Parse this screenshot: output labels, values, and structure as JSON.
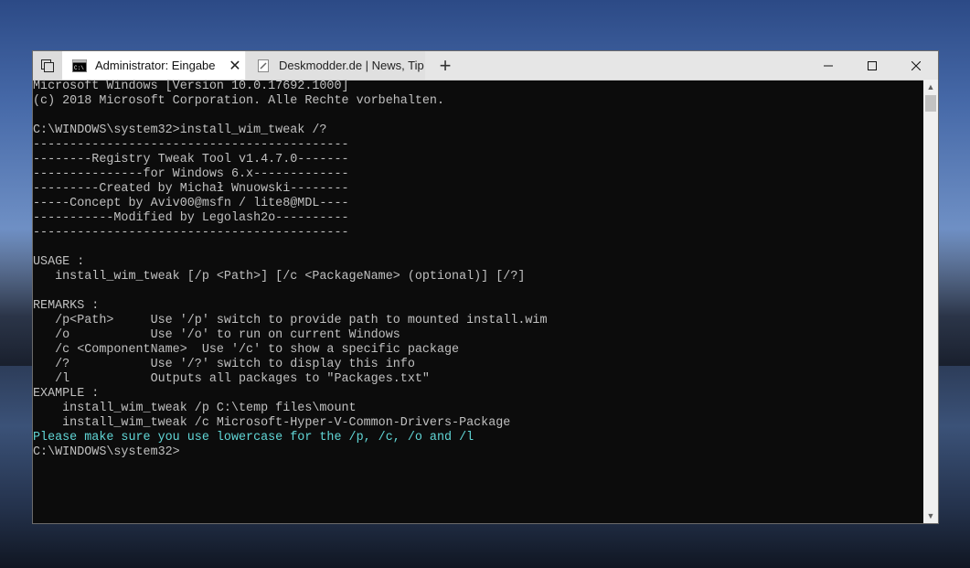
{
  "window": {
    "tabs": [
      {
        "label": "Administrator: Eingabe",
        "close": "✕",
        "icon": "cmd-icon"
      },
      {
        "label": "Deskmodder.de | News, Tip",
        "icon": "page-icon"
      }
    ],
    "new_tab": "+",
    "caption": {
      "minimize": "—",
      "maximize": "☐",
      "close": "✕"
    }
  },
  "console": {
    "lines": [
      "Microsoft Windows [Version 10.0.17692.1000]",
      "(c) 2018 Microsoft Corporation. Alle Rechte vorbehalten.",
      "",
      "C:\\WINDOWS\\system32>install_wim_tweak /?",
      "-------------------------------------------",
      "--------Registry Tweak Tool v1.4.7.0-------",
      "---------------for Windows 6.x-------------",
      "---------Created by Michał Wnuowski--------",
      "-----Concept by Aviv00@msfn / lite8@MDL----",
      "-----------Modified by Legolash2o----------",
      "-------------------------------------------",
      "",
      "USAGE :",
      "   install_wim_tweak [/p <Path>] [/c <PackageName> (optional)] [/?]",
      "",
      "REMARKS :",
      "   /p<Path>     Use '/p' switch to provide path to mounted install.wim",
      "   /o           Use '/o' to run on current Windows",
      "   /c <ComponentName>  Use '/c' to show a specific package",
      "   /?           Use '/?' switch to display this info",
      "   /l           Outputs all packages to \"Packages.txt\"",
      "EXAMPLE :",
      "    install_wim_tweak /p C:\\temp files\\mount",
      "    install_wim_tweak /c Microsoft-Hyper-V-Common-Drivers-Package"
    ],
    "highlight_line": "Please make sure you use lowercase for the /p, /c, /o and /l",
    "prompt": "C:\\WINDOWS\\system32>",
    "colors": {
      "text": "#c0c0c0",
      "highlight": "#61d6d6",
      "background": "#0c0c0c"
    }
  }
}
